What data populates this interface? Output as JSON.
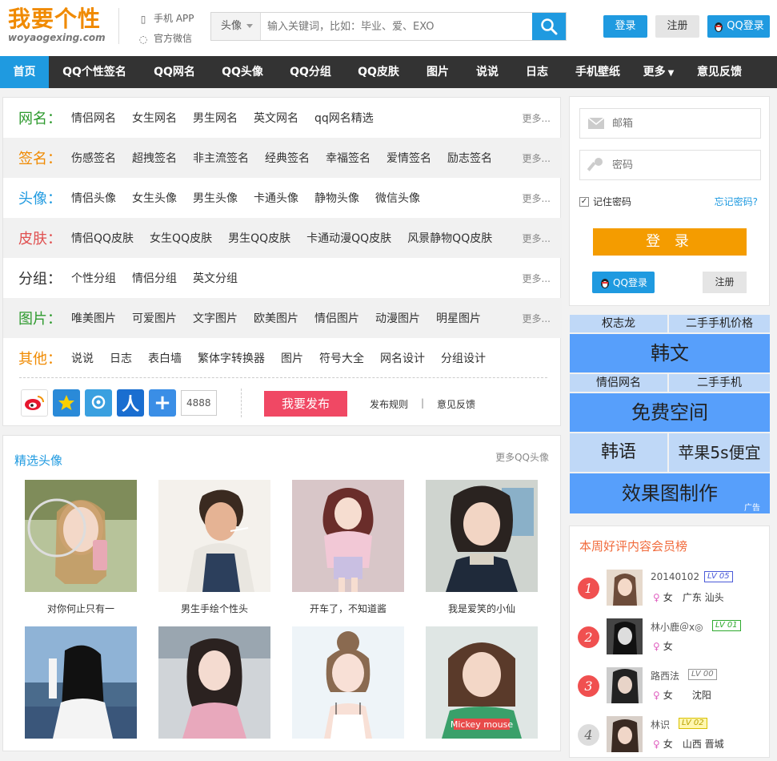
{
  "header": {
    "logo_title": "我要个性",
    "logo_sub": "woyaogexing.com",
    "app_label": "手机 APP",
    "wechat_label": "官方微信",
    "search_type": "头像",
    "search_placeholder": "输入关键词，比如：毕业、爱、EXO",
    "login": "登录",
    "register": "注册",
    "qq_login": "QQ登录"
  },
  "nav": [
    "首页",
    "QQ个性签名",
    "QQ网名",
    "QQ头像",
    "QQ分组",
    "QQ皮肤",
    "图片",
    "说说",
    "日志",
    "手机壁纸",
    "更多",
    "意见反馈"
  ],
  "categories": [
    {
      "label": "网名：",
      "color": "#2e9a2e",
      "items": [
        "情侣网名",
        "女生网名",
        "男生网名",
        "英文网名",
        "qq网名精选"
      ],
      "more": "更多..."
    },
    {
      "label": "签名：",
      "color": "#f08a00",
      "items": [
        "伤感签名",
        "超拽签名",
        "非主流签名",
        "经典签名",
        "幸福签名",
        "爱情签名",
        "励志签名"
      ],
      "more": "更多..."
    },
    {
      "label": "头像：",
      "color": "#1f9ae0",
      "items": [
        "情侣头像",
        "女生头像",
        "男生头像",
        "卡通头像",
        "静物头像",
        "微信头像"
      ],
      "more": "更多..."
    },
    {
      "label": "皮肤：",
      "color": "#e05050",
      "items": [
        "情侣QQ皮肤",
        "女生QQ皮肤",
        "男生QQ皮肤",
        "卡通动漫QQ皮肤",
        "风景静物QQ皮肤"
      ],
      "more": "更多..."
    },
    {
      "label": "分组：",
      "color": "#333333",
      "items": [
        "个性分组",
        "情侣分组",
        "英文分组"
      ],
      "more": "更多..."
    },
    {
      "label": "图片：",
      "color": "#2e9a2e",
      "items": [
        "唯美图片",
        "可爱图片",
        "文字图片",
        "欧美图片",
        "情侣图片",
        "动漫图片",
        "明星图片"
      ],
      "more": "更多..."
    },
    {
      "label": "其他：",
      "color": "#f08a00",
      "items": [
        "说说",
        "日志",
        "表白墙",
        "繁体字转换器",
        "图片",
        "符号大全",
        "网名设计",
        "分组设计"
      ],
      "more": ""
    }
  ],
  "share": {
    "count": "4888",
    "publish": "我要发布",
    "rules": "发布规则",
    "sep": "|",
    "feedback": "意见反馈"
  },
  "avatars": {
    "title": "精选头像",
    "more": "更多QQ头像",
    "items": [
      {
        "caption": "对你何止只有一"
      },
      {
        "caption": "男生手绘个性头"
      },
      {
        "caption": "开车了，不知道酱"
      },
      {
        "caption": "我是爱笑的小仙"
      },
      {
        "caption": ""
      },
      {
        "caption": ""
      },
      {
        "caption": ""
      },
      {
        "caption": ""
      }
    ]
  },
  "sidebar": {
    "email_placeholder": "邮箱",
    "password_placeholder": "密码",
    "remember": "记住密码",
    "forget": "忘记密码?",
    "login": "登 录",
    "qq_login": "QQ登录",
    "register": "注册"
  },
  "ads": {
    "row1": [
      "权志龙",
      "二手手机价格"
    ],
    "big1": "韩文",
    "row2": [
      "情侣网名",
      "二手手机"
    ],
    "big2": "免费空间",
    "row3": [
      "韩语",
      "苹果5s便宜"
    ],
    "big3": "效果图制作",
    "ad_tag": "广告"
  },
  "rank": {
    "title": "本周好评内容会员榜",
    "items": [
      {
        "num": "1",
        "name": "20140102",
        "lv": "LV 05",
        "sex": "女",
        "region": "广东 汕头"
      },
      {
        "num": "2",
        "name": "林小鹿＠x◎",
        "lv": "LV 01",
        "sex": "女",
        "region": ""
      },
      {
        "num": "3",
        "name": "路西法",
        "lv": "LV 00",
        "sex": "女",
        "region": "沈阳"
      },
      {
        "num": "4",
        "name": "林识",
        "lv": "LV 02",
        "sex": "女",
        "region": "山西 晋城"
      }
    ]
  }
}
